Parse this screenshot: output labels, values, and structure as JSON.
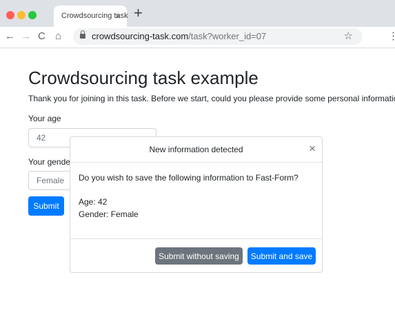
{
  "browser": {
    "tab_title": "Crowdsourcing task",
    "tab_close": "×",
    "new_tab": "+",
    "nav": {
      "back": "←",
      "forward": "→",
      "reload": "C",
      "home": "⌂"
    },
    "url_host": "crowdsourcing-task.com",
    "url_path": "/task?worker_id=07",
    "star": "☆",
    "menu": "⋮"
  },
  "page": {
    "title": "Crowdsourcing task example",
    "intro": "Thank you for joining in this task. Before we start, could you please provide some personal information?",
    "age_label": "Your age",
    "age_value": "42",
    "gender_label": "Your gender",
    "gender_value": "Female",
    "submit_label": "Submit"
  },
  "modal": {
    "title": "New information detected",
    "close": "×",
    "question": "Do you wish to save the following information to Fast-Form?",
    "age_line": "Age: 42",
    "gender_line": "Gender: Female",
    "submit_without_saving": "Submit without saving",
    "submit_and_save": "Submit and save"
  },
  "colors": {
    "primary": "#007bff",
    "secondary": "#6c757d",
    "tabbar": "#dee1e6"
  }
}
